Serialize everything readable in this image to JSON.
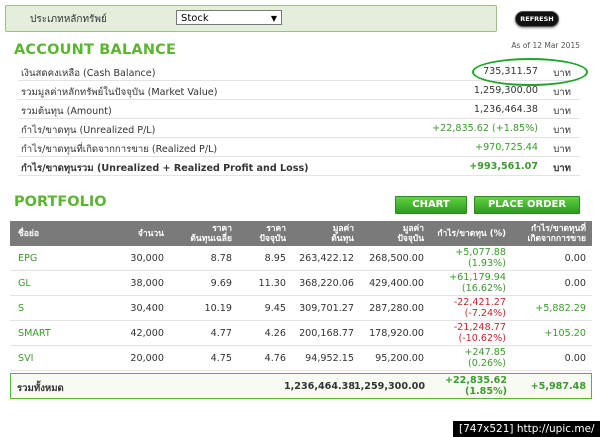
{
  "filter": {
    "label": "ประเภทหลักทรัพย์",
    "selected": "Stock"
  },
  "refresh_label": "REFRESH",
  "as_of": "As of 12 Mar 2015",
  "account": {
    "title": "ACCOUNT BALANCE",
    "rows": [
      {
        "label": "เงินสดคงเหลือ (Cash Balance)",
        "value": "735,311.57",
        "unit": "บาท"
      },
      {
        "label": "รวมมูลค่าหลักทรัพย์ในปัจจุบัน (Market Value)",
        "value": "1,259,300.00",
        "unit": "บาท"
      },
      {
        "label": "รวมต้นทุน (Amount)",
        "value": "1,236,464.38",
        "unit": "บาท"
      },
      {
        "label": "กำไร/ขาดทุน (Unrealized P/L)",
        "value": "+22,835.62 (+1.85%)",
        "unit": "บาท"
      },
      {
        "label": "กำไร/ขาดทุนที่เกิดจากการขาย (Realized P/L)",
        "value": "+970,725.44",
        "unit": "บาท"
      },
      {
        "label": "กำไร/ขาดทุนรวม (Unrealized + Realized Profit and Loss)",
        "value": "+993,561.07",
        "unit": "บาท"
      }
    ]
  },
  "portfolio": {
    "title": "PORTFOLIO",
    "chart_label": "CHART",
    "order_label": "PLACE ORDER",
    "headers": {
      "symbol": "ชื่อย่อ",
      "volume": "จำนวน",
      "avg_cost_1": "ราคา",
      "avg_cost_2": "ต้นทุนเฉลี่ย",
      "price_1": "ราคา",
      "price_2": "ปัจจุบัน",
      "cost_1": "มูลค่า",
      "cost_2": "ต้นทุน",
      "mv_1": "มูลค่า",
      "mv_2": "ปัจจุบัน",
      "upl": "กำไร/ขาดทุน (%)",
      "rpl_1": "กำไร/ขาดทุนที่",
      "rpl_2": "เกิดจากการขาย"
    },
    "rows": [
      {
        "symbol": "EPG",
        "volume": "30,000",
        "avg": "8.78",
        "price": "8.95",
        "cost": "263,422.12",
        "mv": "268,500.00",
        "upl": "+5,077.88",
        "upl_pct": "(1.93%)",
        "rpl": "0.00"
      },
      {
        "symbol": "GL",
        "volume": "38,000",
        "avg": "9.69",
        "price": "11.30",
        "cost": "368,220.06",
        "mv": "429,400.00",
        "upl": "+61,179.94",
        "upl_pct": "(16.62%)",
        "rpl": "0.00"
      },
      {
        "symbol": "S",
        "volume": "30,400",
        "avg": "10.19",
        "price": "9.45",
        "cost": "309,701.27",
        "mv": "287,280.00",
        "upl": "-22,421.27",
        "upl_pct": "(-7.24%)",
        "rpl": "+5,882.29"
      },
      {
        "symbol": "SMART",
        "volume": "42,000",
        "avg": "4.77",
        "price": "4.26",
        "cost": "200,168.77",
        "mv": "178,920.00",
        "upl": "-21,248.77",
        "upl_pct": "(-10.62%)",
        "rpl": "+105.20"
      },
      {
        "symbol": "SVI",
        "volume": "20,000",
        "avg": "4.75",
        "price": "4.76",
        "cost": "94,952.15",
        "mv": "95,200.00",
        "upl": "+247.85",
        "upl_pct": "(0.26%)",
        "rpl": "0.00"
      }
    ],
    "total": {
      "label": "รวมทั้งหมด",
      "cost": "1,236,464.38",
      "mv": "1,259,300.00",
      "upl": "+22,835.62",
      "upl_pct": "(1.85%)",
      "rpl": "+5,987.48"
    }
  },
  "footer": "[747x521] http://upic.me/",
  "colors": {
    "accent": "#5bb531",
    "positive": "#3c9a2e",
    "negative": "#c0282d",
    "header_bg": "#7a7a7a"
  }
}
